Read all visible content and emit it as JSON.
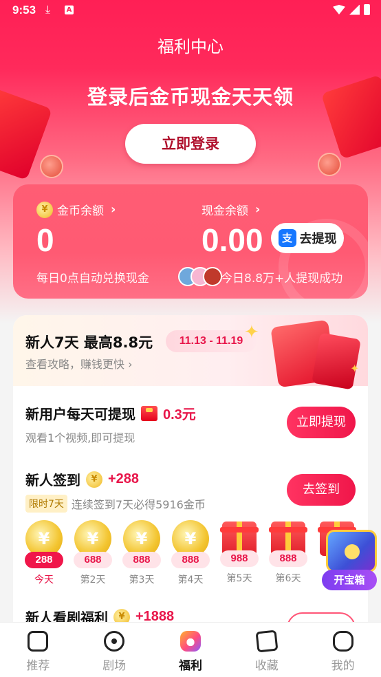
{
  "statusbar": {
    "time": "9:53",
    "download_icon": "download-icon",
    "a_icon": "A"
  },
  "header": {
    "title": "福利中心"
  },
  "promo": {
    "headline": "登录后金币现金天天领",
    "login_button": "立即登录"
  },
  "balance": {
    "coin_label": "金币余额",
    "coin_value": "0",
    "coin_note": "每日0点自动兑换现金",
    "cash_label": "现金余额",
    "cash_value": "0.00",
    "withdraw_button": "去提现",
    "withdraw_icon": "支",
    "cash_note": "今日8.8万+人提现成功"
  },
  "newbie": {
    "title": "新人7天 最高8.8元",
    "date_range": "11.13 - 11.19",
    "subtitle": "查看攻略，赚钱更快 ›"
  },
  "tasks": [
    {
      "title": "新用户每天可提现",
      "reward": "0.3元",
      "desc": "观看1个视频,即可提现",
      "button": "立即提现"
    },
    {
      "title": "新人签到",
      "reward": "+288",
      "tag": "限时7天",
      "desc": "连续签到7天必得5916金币",
      "button": "去签到"
    },
    {
      "title": "新人看剧福利",
      "reward": "+1888"
    }
  ],
  "signin_days": [
    {
      "amount": "288",
      "label": "今天",
      "type": "coin",
      "active": true
    },
    {
      "amount": "688",
      "label": "第2天",
      "type": "coin"
    },
    {
      "amount": "888",
      "label": "第3天",
      "type": "coin"
    },
    {
      "amount": "888",
      "label": "第4天",
      "type": "coin"
    },
    {
      "amount": "988",
      "label": "第5天",
      "type": "gift"
    },
    {
      "amount": "888",
      "label": "第6天",
      "type": "gift"
    }
  ],
  "coin_symbol": "¥",
  "treasure": {
    "label": "开宝箱"
  },
  "nav": [
    {
      "label": "推荐",
      "icon": "recommend-icon"
    },
    {
      "label": "剧场",
      "icon": "theater-icon"
    },
    {
      "label": "福利",
      "icon": "welfare-icon",
      "active": true
    },
    {
      "label": "收藏",
      "icon": "favorites-icon"
    },
    {
      "label": "我的",
      "icon": "profile-icon"
    }
  ],
  "colors": {
    "brand": "#ff2a5b",
    "accent": "#e8164a",
    "cta": "#f0164a"
  }
}
